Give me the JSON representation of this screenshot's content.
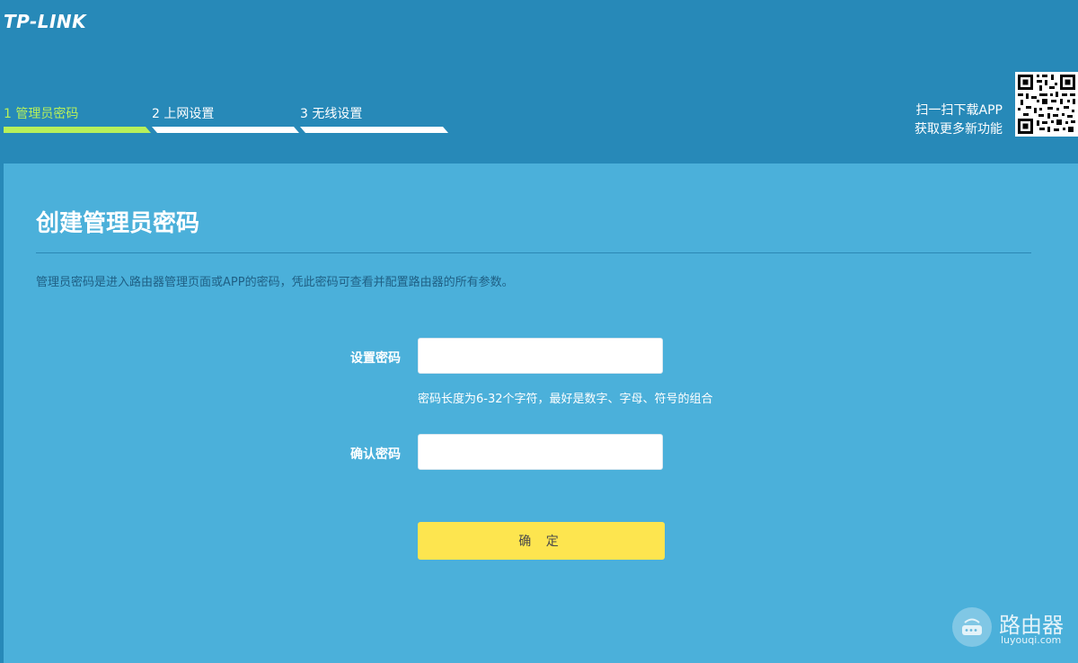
{
  "brand": {
    "logo_text": "TP-LINK"
  },
  "steps": [
    {
      "label": "1 管理员密码",
      "active": true
    },
    {
      "label": "2 上网设置",
      "active": false
    },
    {
      "label": "3 无线设置",
      "active": false
    }
  ],
  "app_promo": {
    "line1": "扫一扫下载APP",
    "line2": "获取更多新功能"
  },
  "page": {
    "title": "创建管理员密码",
    "description": "管理员密码是进入路由器管理页面或APP的密码，凭此密码可查看并配置路由器的所有参数。"
  },
  "form": {
    "password_label": "设置密码",
    "password_value": "",
    "password_hint": "密码长度为6-32个字符，最好是数字、字母、符号的组合",
    "confirm_label": "确认密码",
    "confirm_value": "",
    "submit_label": "确 定"
  },
  "watermark": {
    "text": "路由器",
    "url_text": "luyouqi.com"
  },
  "colors": {
    "header_bg": "#2789b8",
    "main_bg": "#4bb0da",
    "active_step": "#b7f05a",
    "button_bg": "#fde54f"
  }
}
